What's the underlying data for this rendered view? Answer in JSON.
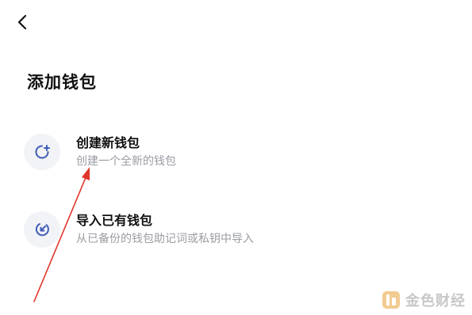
{
  "header": {
    "back_icon": "chevron-left-icon"
  },
  "page": {
    "title": "添加钱包"
  },
  "options": [
    {
      "title": "创建新钱包",
      "subtitle": "创建一个全新的钱包",
      "icon": "circle-plus-icon"
    },
    {
      "title": "导入已有钱包",
      "subtitle": "从已备份的钱包助记词或私钥中导入",
      "icon": "circle-import-icon"
    }
  ],
  "watermark": {
    "text": "金色财经",
    "logo_color": "#e8a23a"
  },
  "colors": {
    "accent_icon": "#3e5bb8",
    "annotation_arrow": "#e0352b"
  }
}
